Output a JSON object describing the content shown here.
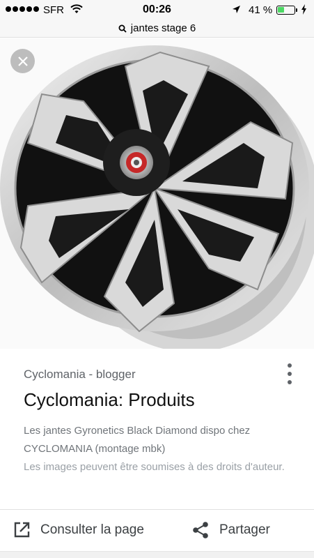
{
  "status_bar": {
    "carrier": "SFR",
    "time": "00:26",
    "battery_percent": "41 %",
    "battery_level": 0.41,
    "battery_color": "#4cd964"
  },
  "search": {
    "query": "jantes stage 6",
    "icon": "search-icon"
  },
  "viewer": {
    "close_icon": "close-icon",
    "image_subject": "wheel-rim-image"
  },
  "card": {
    "source": "Cyclomania - blogger",
    "title": "Cyclomania: Produits",
    "description": "Les jantes Gyronetics Black Diamond dispo chez CYCLOMANIA (montage mbk)",
    "rights_notice": "Les images peuvent être soumises à des droits d'auteur.",
    "menu_icon": "more-vert-icon",
    "visit_label": "Consulter la page",
    "visit_icon": "open-in-new-icon",
    "share_label": "Partager",
    "share_icon": "share-icon"
  }
}
